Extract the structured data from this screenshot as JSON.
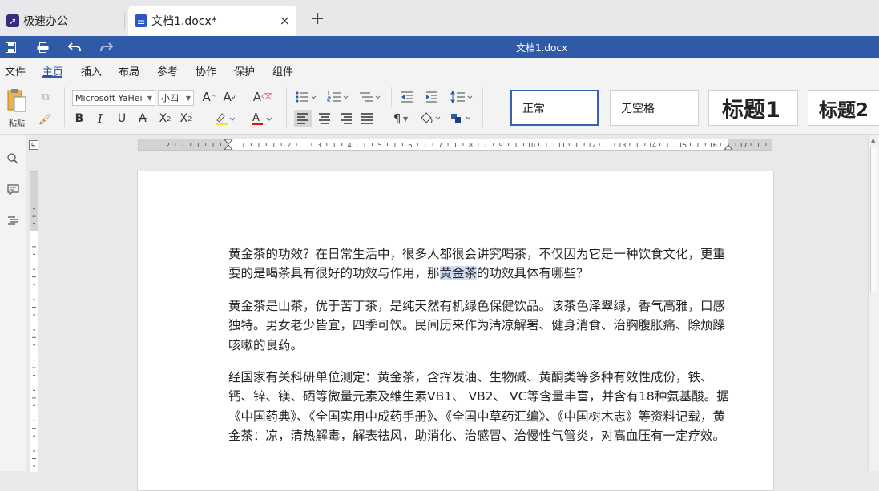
{
  "tabs": [
    {
      "label": "极速办公"
    },
    {
      "label": "文档1.docx*",
      "close": "×"
    }
  ],
  "add_tab": "+",
  "window_title": "文档1.docx",
  "menu": [
    "文件",
    "主页",
    "插入",
    "布局",
    "参考",
    "协作",
    "保护",
    "组件"
  ],
  "active_menu": "主页",
  "ribbon": {
    "paste_label": "粘贴",
    "font_name": "Microsoft YaHei",
    "font_size": "小四",
    "styles": [
      "正常",
      "无空格",
      "标题1",
      "标题2"
    ]
  },
  "document": {
    "p1_before": "黄金茶的功效？在日常生活中，很多人都很会讲究喝茶，不仅因为它是一种饮食文化，更重要的是喝茶具有很好的功效与作用，那",
    "p1_selected": "黄金茶",
    "p1_after": "的功效具体有哪些？",
    "p2": "黄金茶是山茶，优于苦丁茶，是纯天然有机绿色保健饮品。该茶色泽翠绿，香气高雅，口感独特。男女老少皆宜，四季可饮。民间历来作为清凉解署、健身消食、治胸腹胀痛、除烦躁咳嗽的良药。",
    "p3": "经国家有关科研单位测定：黄金茶，含挥发油、生物碱、黄酮类等多种有效性成份，铁、钙、锌、镁、硒等微量元素及维生素VB1、 VB2、 VC等含量丰富，并含有18种氨基酸。据《中国药典》、《全国实用中成药手册》、《全国中草药汇编》、《中国树木志》等资料记载，黄金茶：凉，清热解毒，解表祛风，助消化、治感冒、治慢性气管炎，对高血压有一定疗效。"
  },
  "colors": {
    "accent": "#2e5aa8",
    "selection": "#cfdcf1"
  }
}
